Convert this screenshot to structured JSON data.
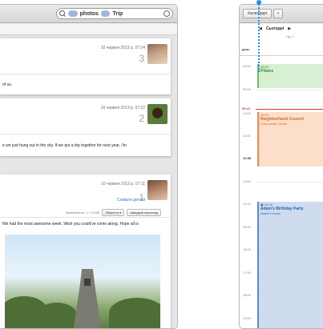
{
  "mail": {
    "search": {
      "token1_label": "photos",
      "token2_label": "Trip"
    },
    "messages": [
      {
        "date": "10 червня 2013 р. 07:24",
        "count": "3",
        "body": "of us."
      },
      {
        "date": "10 червня 2013 р. 07:22",
        "count": "2",
        "body": "e we just hung out in the city. If we put a trip together for next year, I'm"
      },
      {
        "date": "10 червня 2013 р. 07:11",
        "hide_details": "Сховати деталі",
        "count": "1",
        "attachment_info": "Прикріплено: 1, 1,9 МБ",
        "save_label": "Зберегти",
        "quicklook_label": "Швидкий перегляд",
        "body": "We had the most awesome week. Wish you could've come along. Hope all is"
      }
    ]
  },
  "calendar": {
    "calendars_button": "Календарі",
    "add_button": "+",
    "nav": {
      "prev": "◀",
      "today": "Сьогодні",
      "next": "▶"
    },
    "week_label": "Нд, 9",
    "allday_label": "день",
    "now_time": "09:41",
    "hours": [
      "08:00",
      "09:00",
      "10:00",
      "11:00",
      "12:00",
      "13:00",
      "14:00",
      "15:00",
      "16:00",
      "17:00",
      "18:00",
      "19:00"
    ],
    "events": [
      {
        "time": "08:00",
        "title": "Pilates",
        "location": ""
      },
      {
        "time": "10:00",
        "title": "Neighborhood Council",
        "location": "Community Center"
      },
      {
        "time": "14:00",
        "title": "Adam's Birthday Party",
        "location": "Adam's house"
      }
    ]
  }
}
